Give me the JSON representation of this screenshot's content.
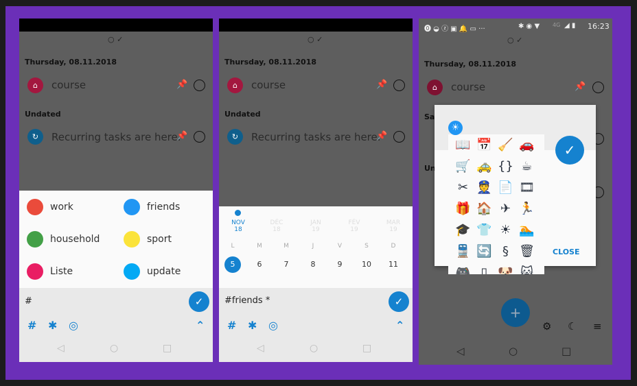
{
  "task_list": {
    "date_header": "Thursday, 08.11.2018",
    "task1": "course",
    "undated_header": "Undated",
    "task2": "Recurring tasks are here.",
    "partial_header_1": "Sat",
    "partial_header_2": "Un"
  },
  "panel1": {
    "tags": [
      {
        "label": "work",
        "color": "#ea4b3b"
      },
      {
        "label": "friends",
        "color": "#2196f3"
      },
      {
        "label": "household",
        "color": "#43a047"
      },
      {
        "label": "sport",
        "color": "#fbe33a"
      },
      {
        "label": "Liste",
        "color": "#e91e63"
      },
      {
        "label": "update",
        "color": "#03a9f4"
      }
    ],
    "input_value": "#"
  },
  "panel2": {
    "months": [
      {
        "m": "NOV",
        "y": "18"
      },
      {
        "m": "DÉC",
        "y": "18"
      },
      {
        "m": "JAN",
        "y": "19"
      },
      {
        "m": "FÉV",
        "y": "19"
      },
      {
        "m": "MAR",
        "y": "19"
      }
    ],
    "weekdays": [
      "L",
      "M",
      "M",
      "J",
      "V",
      "S",
      "D"
    ],
    "days": [
      "5",
      "6",
      "7",
      "8",
      "9",
      "10",
      "11"
    ],
    "selected_day": "5",
    "input_value": "#friends *"
  },
  "panel3": {
    "status_time": "16:23",
    "network": "4G",
    "close_label": "CLOSE",
    "icons": [
      "📖",
      "📅",
      "🧹",
      "🚗",
      "🛒",
      "🚕",
      "{}",
      "☕",
      "✂",
      "👮",
      "📄",
      "🎞",
      "🎁",
      "🏠",
      "✈",
      "🏃",
      "🎓",
      "👕",
      "☀",
      "🏊",
      "🚆",
      "🔄",
      "§",
      "🗑",
      "🎮",
      "▯",
      "🐶",
      "🐱"
    ]
  },
  "colors": {
    "accent": "#1582cf",
    "frame": "#6b2fb8"
  }
}
